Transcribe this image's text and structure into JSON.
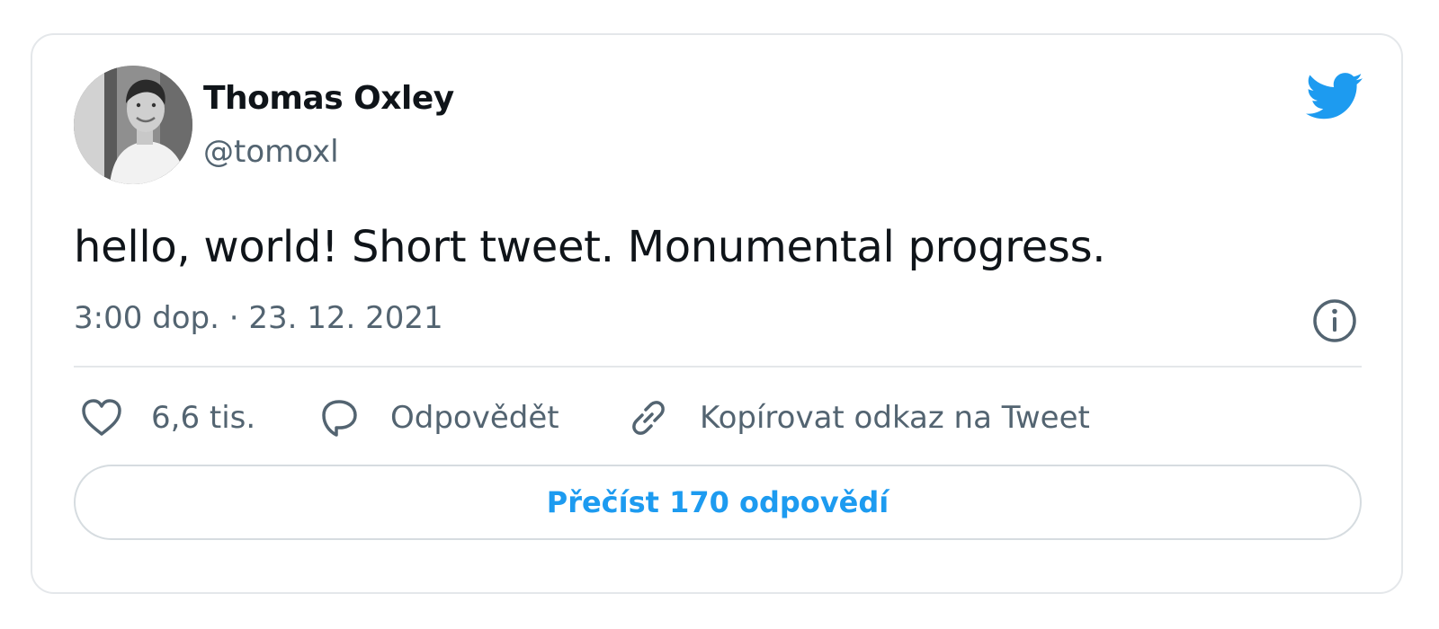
{
  "author": {
    "name": "Thomas Oxley",
    "handle": "@tomoxl"
  },
  "tweet": {
    "text": "hello, world! Short tweet. Monumental progress.",
    "timestamp": "3:00 dop. · 23. 12. 2021"
  },
  "actions": {
    "like_count": "6,6 tis.",
    "reply_label": "Odpovědět",
    "copy_link_label": "Kopírovat odkaz na Tweet"
  },
  "read_replies_label": "Přečíst 170 odpovědí",
  "icons": {
    "brand": "twitter-bird-icon",
    "info": "info-icon",
    "like": "heart-icon",
    "reply": "speech-bubble-icon",
    "copy_link": "link-icon"
  },
  "colors": {
    "brand": "#1d9bf0",
    "text": "#0f1419",
    "muted": "#536471",
    "border": "#e4e7ea"
  }
}
